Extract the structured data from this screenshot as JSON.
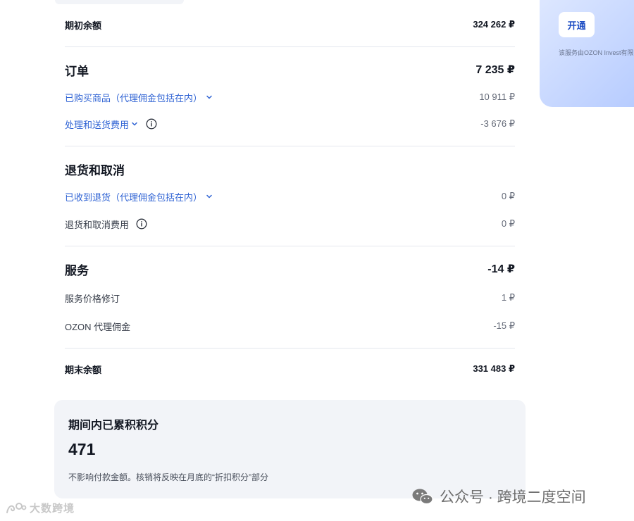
{
  "report": {
    "opening_balance": {
      "label": "期初余额",
      "amount": "324 262 ₽"
    },
    "orders": {
      "title": "订单",
      "total": "7 235 ₽",
      "purchased_goods": {
        "label": "已购买商品（代理佣金包括在内）",
        "amount": "10 911 ₽"
      },
      "processing_fees": {
        "label": "处理和送货费用",
        "amount": "-3 676 ₽"
      }
    },
    "returns": {
      "title": "退货和取消",
      "received_returns": {
        "label": "已收到退货（代理佣金包括在内）",
        "amount": "0 ₽"
      },
      "return_fees": {
        "label": "退货和取消费用",
        "amount": "0 ₽"
      }
    },
    "services": {
      "title": "服务",
      "total": "-14 ₽",
      "price_revision": {
        "label": "服务价格修订",
        "amount": "1 ₽"
      },
      "agent_commission": {
        "label": "OZON 代理佣金",
        "amount": "-15 ₽"
      }
    },
    "closing_balance": {
      "label": "期末余额",
      "amount": "331 483 ₽"
    }
  },
  "points": {
    "title": "期间内已累积积分",
    "value": "471",
    "note": "不影响付款金额。核销将反映在月底的“折扣积分”部分"
  },
  "promo": {
    "button_label": "开通",
    "note": "该服务由OZON Invest有限"
  },
  "watermarks": {
    "left": "大数跨境",
    "right": "公众号 · 跨境二度空间"
  },
  "icons": [
    "chevron-down-icon",
    "info-icon",
    "wechat-icon",
    "logo-icon"
  ],
  "colors": {
    "link": "#2f63d4",
    "card_bg": "#f2f4f8",
    "promo_bg": "#c4d5ff"
  }
}
